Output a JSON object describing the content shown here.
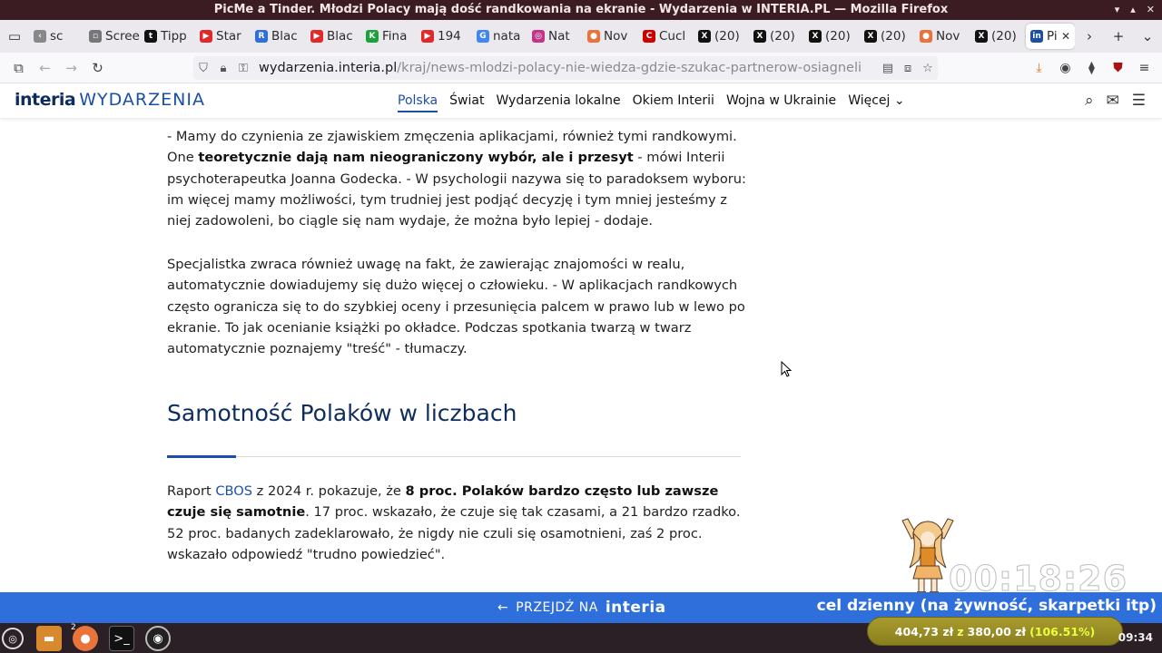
{
  "window": {
    "title": "PicMe a Tinder. Młodzi Polacy mają dość randkowania na ekranie - Wydarzenia w INTERIA.PL — Mozilla Firefox"
  },
  "tabs": [
    {
      "label": "sc",
      "icon": "chevron-left-icon",
      "color": "#888888"
    },
    {
      "label": "Screen",
      "icon": "page-icon",
      "color": "#777777"
    },
    {
      "label": "Tipp",
      "icon": "tipply-icon",
      "color": "#111111"
    },
    {
      "label": "Star",
      "icon": "youtube-icon",
      "color": "#e02a2a"
    },
    {
      "label": "Blac",
      "icon": "r-icon",
      "color": "#2f6fdc"
    },
    {
      "label": "Blac",
      "icon": "youtube-icon",
      "color": "#e02a2a"
    },
    {
      "label": "Fina",
      "icon": "k-icon",
      "color": "#1aa33a"
    },
    {
      "label": "194",
      "icon": "youtube-audio-icon",
      "color": "#e02a2a"
    },
    {
      "label": "nata",
      "icon": "google-icon",
      "color": "#4285f4"
    },
    {
      "label": "Nat",
      "icon": "instagram-icon",
      "color": "#c1358a"
    },
    {
      "label": "Nov",
      "icon": "firefox-icon",
      "color": "#e8743b"
    },
    {
      "label": "Cucl",
      "icon": "cnn-icon",
      "color": "#cc0000"
    },
    {
      "label": "(20)",
      "icon": "x-icon",
      "color": "#111111"
    },
    {
      "label": "(20)",
      "icon": "x-icon",
      "color": "#111111"
    },
    {
      "label": "(20)",
      "icon": "x-icon",
      "color": "#111111"
    },
    {
      "label": "(20)",
      "icon": "x-icon",
      "color": "#111111"
    },
    {
      "label": "Nov",
      "icon": "firefox-icon",
      "color": "#e8743b"
    },
    {
      "label": "(20)",
      "icon": "x-icon",
      "color": "#111111"
    },
    {
      "label": "Pi",
      "icon": "interia-icon",
      "color": "#1b4fa7",
      "active": true
    }
  ],
  "address_bar": {
    "host": "wydarzenia.interia.pl",
    "path": "/kraj/news-mlodzi-polacy-nie-wiedza-gdzie-szukac-partnerow-osiagnelismy,n"
  },
  "site": {
    "brand": "interia",
    "section": "WYDARZENIA",
    "menu": [
      "Polska",
      "Świat",
      "Wydarzenia lokalne",
      "Okiem Interii",
      "Wojna w Ukrainie",
      "Więcej"
    ],
    "active_menu": "Polska"
  },
  "article": {
    "p1_a": "- Mamy do czynienia ze zjawiskiem zmęczenia aplikacjami, również tymi randkowymi. One ",
    "p1_b": "teoretycznie dają nam nieograniczony wybór, ale i przesyt",
    "p1_c": " - mówi Interii psychoterapeutka Joanna Godecka. - W psychologii nazywa się to paradoksem wyboru: im więcej mamy możliwości, tym trudniej jest podjąć decyzję i tym mniej jesteśmy z niej zadowoleni, bo ciągle się nam wydaje, że można było lepiej - dodaje.",
    "p2": "Specjalistka zwraca również uwagę na fakt, że zawierając znajomości w realu, automatycznie dowiadujemy się dużo więcej o człowieku. - W aplikacjach randkowych często ogranicza się to do szybkiej oceny i przesunięcia palcem w prawo lub w lewo po ekranie. To jak ocenianie książki po okładce. Podczas spotkania twarzą w twarz automatycznie poznajemy \"treść\" - tłumaczy.",
    "heading": "Samotność Polaków w liczbach",
    "p3_a": "Raport ",
    "p3_link": "CBOS",
    "p3_b": " z 2024 r. pokazuje, że ",
    "p3_bold": "8 proc. Polaków bardzo często lub zawsze czuje się samotnie",
    "p3_c": ". 17 proc. wskazało, że czuje się tak czasami, a 21 bardzo rzadko. 52 proc. badanych zadeklarowało, że nigdy nie czuli się osamotnieni, zaś 2 proc. wskazało odpowiedź \"trudno powiedzieć\"."
  },
  "bottom_banner": {
    "prefix": "PRZEJDŹ NA",
    "brand": "interia"
  },
  "stream_overlay": {
    "timer": "00:18:26",
    "goal_text": "cel dzienny (na żywność, skarpetki itp)",
    "amount_current": "404,73 zł",
    "amount_sep": "z",
    "amount_goal": "380,00 zł",
    "amount_pct": "(106.51%)"
  },
  "taskbar": {
    "firefox_badge": "2",
    "clock": "09:34"
  },
  "colors": {
    "accent": "#1b4fa7",
    "banner": "#2f6fdc",
    "titlebar": "#3b1c22"
  }
}
